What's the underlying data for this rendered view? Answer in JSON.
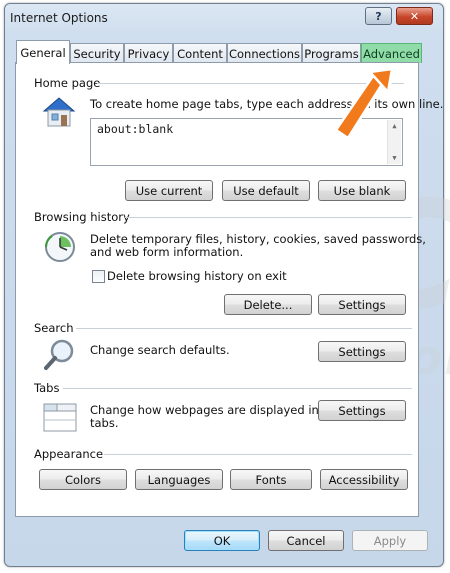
{
  "window": {
    "title": "Internet Options",
    "help_glyph": "?",
    "close_glyph": "✕"
  },
  "tabs": [
    {
      "label": "General"
    },
    {
      "label": "Security"
    },
    {
      "label": "Privacy"
    },
    {
      "label": "Content"
    },
    {
      "label": "Connections"
    },
    {
      "label": "Programs"
    },
    {
      "label": "Advanced"
    }
  ],
  "home_page": {
    "label": "Home page",
    "description": "To create home page tabs, type each address on its own line.",
    "value": "about:blank",
    "buttons": {
      "use_current": "Use current",
      "use_default": "Use default",
      "use_blank": "Use blank"
    }
  },
  "browsing_history": {
    "label": "Browsing history",
    "description_1": "Delete temporary files, history, cookies, saved passwords,",
    "description_2": "and web form information.",
    "checkbox_label": "Delete browsing history on exit",
    "buttons": {
      "delete": "Delete...",
      "settings": "Settings"
    }
  },
  "search": {
    "label": "Search",
    "description": "Change search defaults.",
    "settings": "Settings"
  },
  "tabs_section": {
    "label": "Tabs",
    "description_1": "Change how webpages are displayed in",
    "description_2": "tabs.",
    "settings": "Settings"
  },
  "appearance": {
    "label": "Appearance",
    "buttons": {
      "colors": "Colors",
      "languages": "Languages",
      "fonts": "Fonts",
      "accessibility": "Accessibility"
    }
  },
  "footer": {
    "ok": "OK",
    "cancel": "Cancel",
    "apply": "Apply"
  },
  "colors": {
    "highlight_tab": "#8fdca8",
    "arrow": "#f07a1c"
  }
}
